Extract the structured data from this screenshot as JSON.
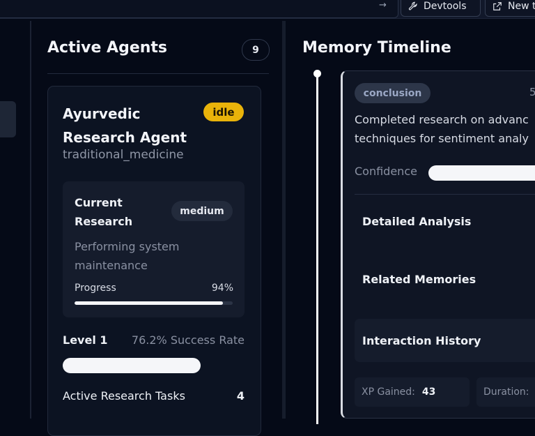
{
  "toolbar": {
    "devtools_label": "Devtools",
    "new_label": "New t"
  },
  "agents": {
    "title": "Active Agents",
    "count": "9",
    "card": {
      "name": "Ayurvedic Research Agent",
      "status": "idle",
      "domain": "traditional_medicine",
      "research": {
        "title": "Current Research",
        "priority": "medium",
        "description": "Performing system maintenance",
        "progress_label": "Progress",
        "progress_value": "94%",
        "progress_fraction": 0.94
      },
      "level": "Level 1",
      "success_rate": "76.2% Success Rate",
      "level_progress_fraction": 0.76,
      "tasks_label": "Active Research Tasks",
      "tasks_count": "4"
    }
  },
  "timeline": {
    "title": "Memory Timeline",
    "memory": {
      "type": "conclusion",
      "corner": "5",
      "text_line1": "Completed research on advanc",
      "text_line2": "techniques for sentiment analy",
      "confidence_label": "Confidence",
      "sections": [
        "Detailed Analysis",
        "Related Memories",
        "Interaction History"
      ],
      "xp_label": "XP Gained:",
      "xp_value": "43",
      "duration_label": "Duration:"
    }
  },
  "colors": {
    "background": "#050a17",
    "idle_badge": "#e9b30a",
    "card": "#0c1322"
  }
}
